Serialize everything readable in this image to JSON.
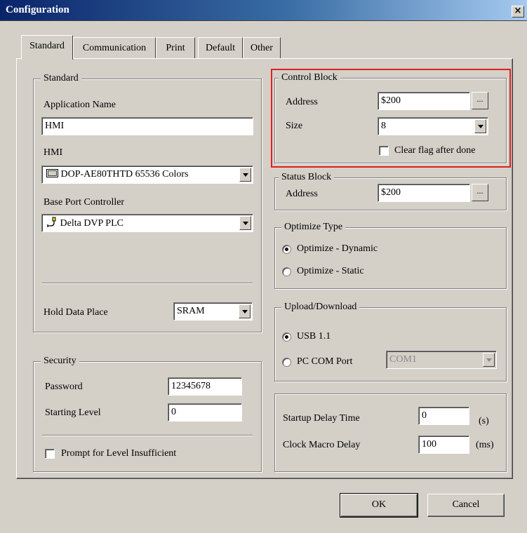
{
  "window": {
    "title": "Configuration",
    "close_label": "×"
  },
  "tabs": [
    {
      "label": "Standard",
      "active": true
    },
    {
      "label": "Communication",
      "active": false
    },
    {
      "label": "Print",
      "active": false
    },
    {
      "label": "Default",
      "active": false
    },
    {
      "label": "Other",
      "active": false
    }
  ],
  "standard": {
    "group_title": "Standard",
    "app_name_label": "Application Name",
    "app_name_value": "HMI",
    "hmi_label": "HMI",
    "hmi_value": "DOP-AE80THTD 65536 Colors",
    "base_port_label": "Base Port Controller",
    "base_port_value": "Delta DVP PLC",
    "hold_data_label": "Hold Data Place",
    "hold_data_value": "SRAM"
  },
  "security": {
    "group_title": "Security",
    "password_label": "Password",
    "password_value": "12345678",
    "starting_level_label": "Starting Level",
    "starting_level_value": "0",
    "prompt_label": "Prompt for Level Insufficient",
    "prompt_checked": false
  },
  "control_block": {
    "group_title": "Control Block",
    "address_label": "Address",
    "address_value": "$200",
    "size_label": "Size",
    "size_value": "8",
    "clear_flag_label": "Clear flag after done",
    "clear_flag_checked": false,
    "browse_label": "..."
  },
  "status_block": {
    "group_title": "Status Block",
    "address_label": "Address",
    "address_value": "$200",
    "browse_label": "..."
  },
  "optimize": {
    "group_title": "Optimize Type",
    "options": [
      {
        "label": "Optimize - Dynamic",
        "selected": true
      },
      {
        "label": "Optimize - Static",
        "selected": false
      }
    ]
  },
  "upload": {
    "group_title": "Upload/Download",
    "usb_label": "USB 1.1",
    "usb_selected": true,
    "pc_com_label": "PC COM Port",
    "pc_com_selected": false,
    "com_value": "COM1"
  },
  "timing": {
    "startup_label": "Startup Delay Time",
    "startup_value": "0",
    "startup_unit": "(s)",
    "clock_label": "Clock Macro Delay",
    "clock_value": "100",
    "clock_unit": "(ms)"
  },
  "buttons": {
    "ok_label": "OK",
    "cancel_label": "Cancel"
  },
  "colors": {
    "highlight": "#e02020",
    "titlebar": "#0a246a",
    "face": "#d4d0c8"
  },
  "icons": {
    "hmi_icon": "monitor-icon",
    "plc_icon": "plc-connector-icon"
  }
}
